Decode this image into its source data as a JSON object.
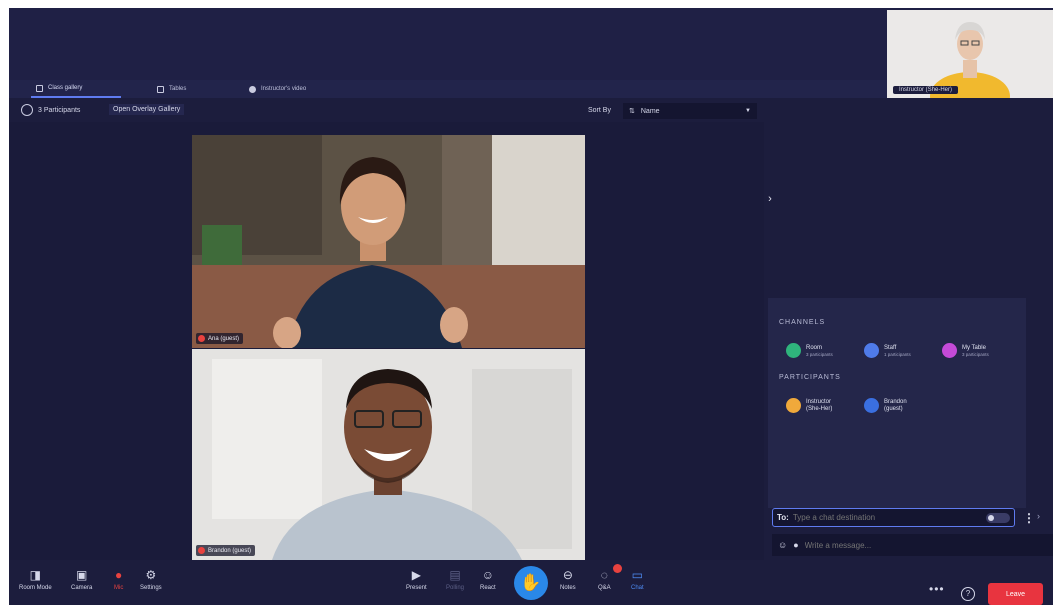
{
  "self_view": {
    "label": "Instructor (She-Her)"
  },
  "tabs": [
    {
      "label": "Class gallery",
      "active": true
    },
    {
      "label": "Tables",
      "active": false
    },
    {
      "label": "Instructor's video",
      "active": false
    }
  ],
  "gallery": {
    "participants_count": "3 Participants",
    "overlay_button": "Open Overlay Gallery",
    "sort_label": "Sort By",
    "sort_value": "Name"
  },
  "tiles": [
    {
      "name": "Ana (guest)",
      "mic_muted": true
    },
    {
      "name": "Brandon (guest)",
      "mic_muted": true
    }
  ],
  "chat": {
    "channels_heading": "CHANNELS",
    "channels": [
      {
        "name": "Room",
        "sub": "3 participants",
        "color": "#2fb47c"
      },
      {
        "name": "Staff",
        "sub": "1 participants",
        "color": "#4f7be9"
      },
      {
        "name": "My Table",
        "sub": "3 participants",
        "color": "#c44ad8"
      }
    ],
    "participants_heading": "PARTICIPANTS",
    "participants": [
      {
        "name": "Instructor",
        "sub": "(She-Her)",
        "color": "#f0a93b"
      },
      {
        "name": "Brandon",
        "sub": "(guest)",
        "color": "#3a6fe0"
      }
    ],
    "to_label": "To:",
    "to_placeholder": "Type a chat destination",
    "message_placeholder": "Write a message..."
  },
  "controls": {
    "left": [
      {
        "label": "Room Mode",
        "icon": "room-mode-icon"
      },
      {
        "label": "Camera",
        "icon": "camera-icon"
      },
      {
        "label": "Mic",
        "icon": "mic-off-icon"
      },
      {
        "label": "Settings",
        "icon": "gear-icon"
      }
    ],
    "center": [
      {
        "label": "Present",
        "icon": "present-icon"
      },
      {
        "label": "Polling",
        "icon": "polling-icon"
      },
      {
        "label": "React",
        "icon": "react-icon"
      },
      {
        "label": "Notes",
        "icon": "notes-icon"
      },
      {
        "label": "Q&A",
        "icon": "qa-icon"
      },
      {
        "label": "Chat",
        "icon": "chat-icon"
      }
    ],
    "leave_label": "Leave"
  }
}
